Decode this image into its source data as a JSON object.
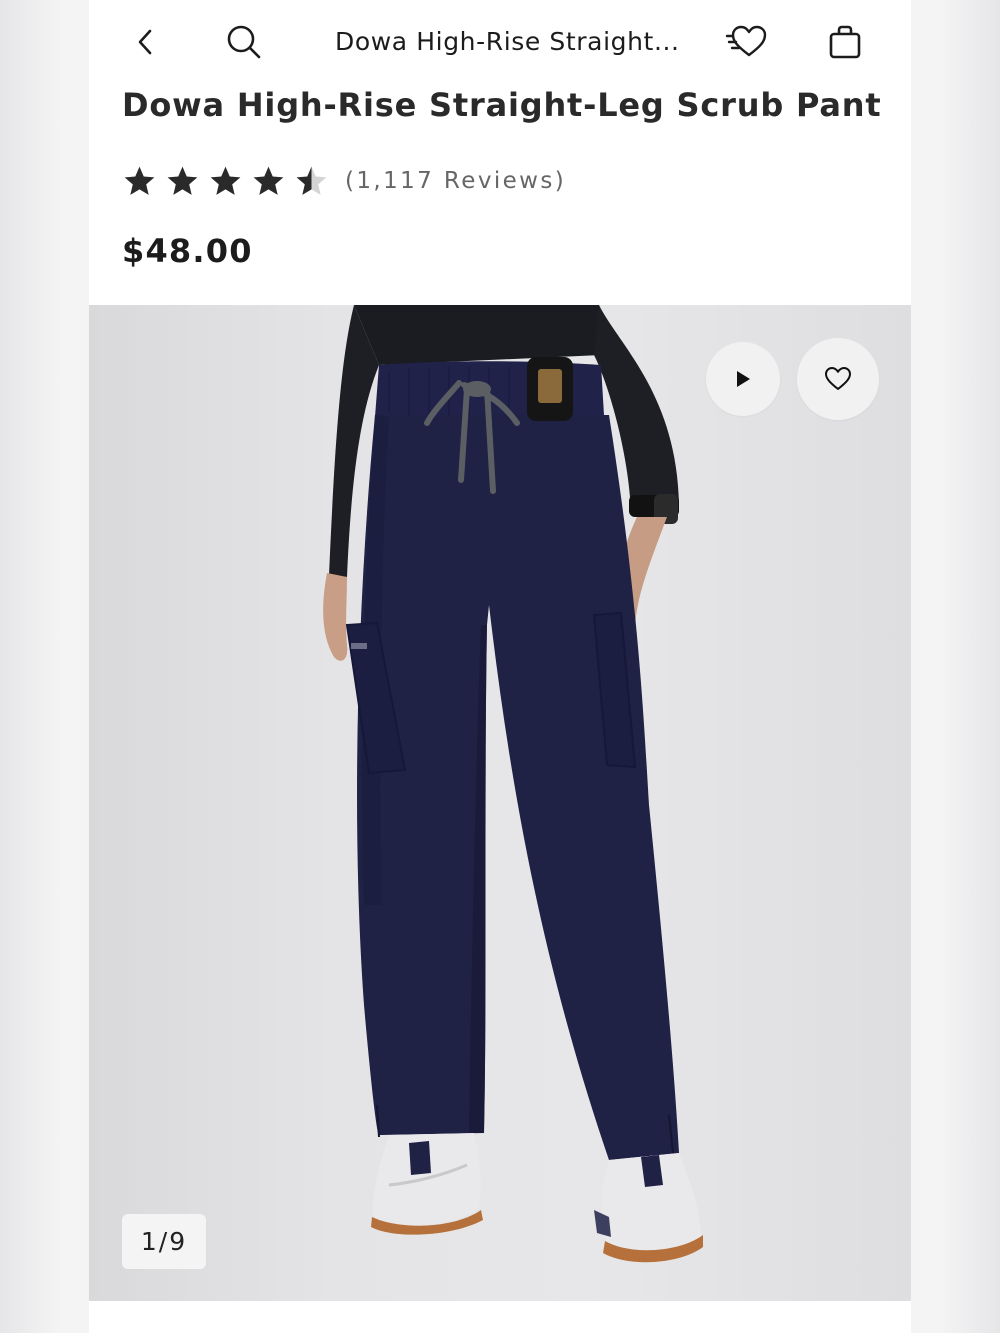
{
  "nav": {
    "back_icon": "chevron-left-icon",
    "search_icon": "search-icon",
    "title": "Dowa High-Rise Straight...",
    "wishlist_icon": "heart-list-icon",
    "bag_icon": "shopping-bag-icon"
  },
  "product": {
    "title": "Dowa High-Rise Straight-Leg Scrub Pant",
    "rating": 4.5,
    "rating_max": 5,
    "reviews_text": "(1,117 Reviews)",
    "price": "$48.00"
  },
  "gallery": {
    "counter": "1/9",
    "current": 1,
    "total": 9,
    "play_icon": "play-icon",
    "favorite_icon": "heart-icon"
  },
  "colors": {
    "pant_navy": "#1f2145",
    "text_dark": "#1c1c1c",
    "star": "#2a2a2a"
  }
}
